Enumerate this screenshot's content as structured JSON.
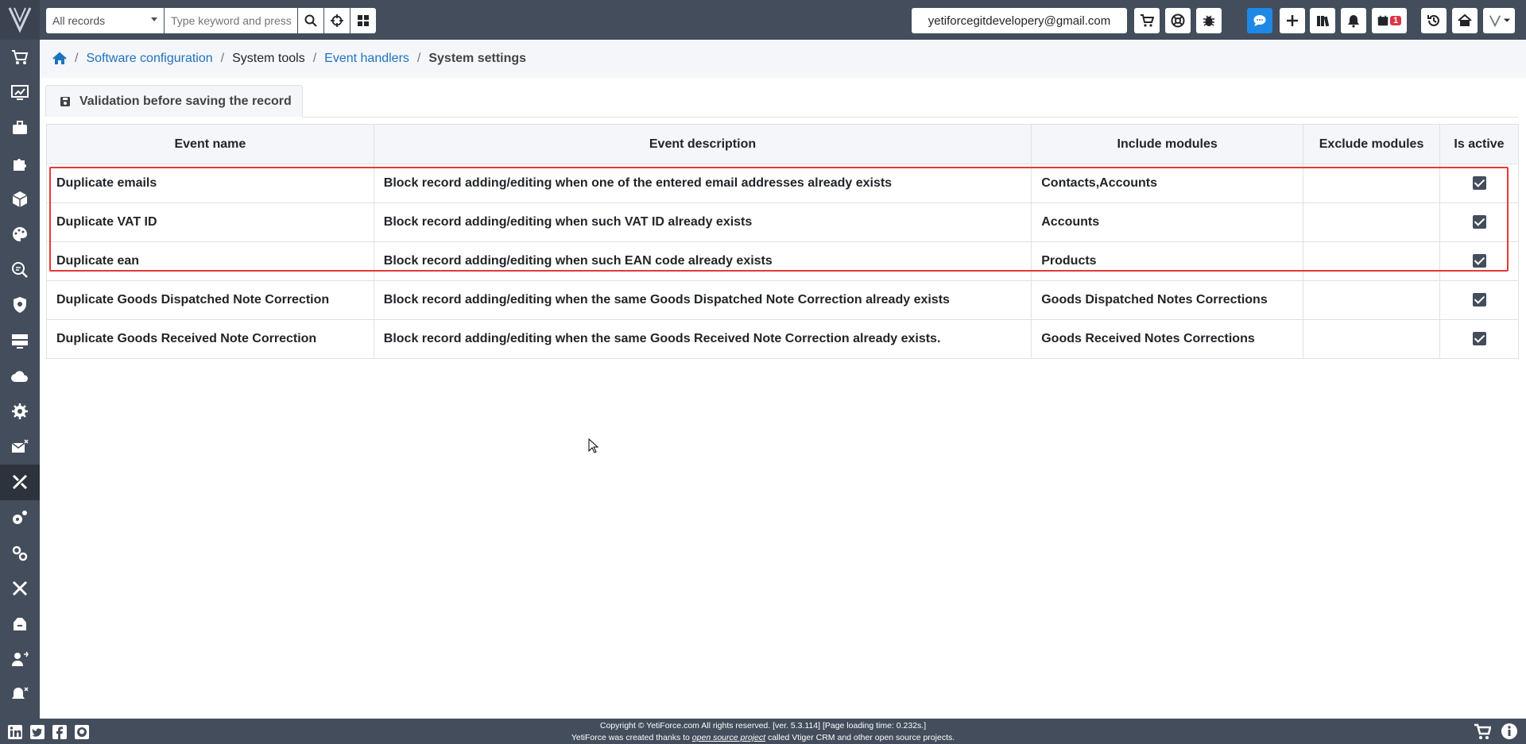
{
  "topbar": {
    "records_select": "All records",
    "search_placeholder": "Type keyword and press",
    "user_email": "yetiforcegitdevelopery@gmail.com",
    "calendar_badge": "1"
  },
  "breadcrumb": {
    "items": [
      "Software configuration",
      "System tools",
      "Event handlers",
      "System settings"
    ]
  },
  "tab": {
    "label": "Validation before saving the record"
  },
  "table": {
    "columns": [
      "Event name",
      "Event description",
      "Include modules",
      "Exclude modules",
      "Is active"
    ],
    "rows": [
      {
        "name": "Duplicate emails",
        "description": "Block record adding/editing when one of the entered email addresses already exists",
        "include": "Contacts,Accounts",
        "exclude": "",
        "active": true
      },
      {
        "name": "Duplicate VAT ID",
        "description": "Block record adding/editing when such VAT ID already exists",
        "include": "Accounts",
        "exclude": "",
        "active": true
      },
      {
        "name": "Duplicate ean",
        "description": "Block record adding/editing when such EAN code already exists",
        "include": "Products",
        "exclude": "",
        "active": true
      },
      {
        "name": "Duplicate Goods Dispatched Note Correction",
        "description": "Block record adding/editing when the same Goods Dispatched Note Correction already exists",
        "include": "Goods Dispatched Notes Corrections",
        "exclude": "",
        "active": true
      },
      {
        "name": "Duplicate Goods Received Note Correction",
        "description": "Block record adding/editing when the same Goods Received Note Correction already exists.",
        "include": "Goods Received Notes Corrections",
        "exclude": "",
        "active": true
      }
    ]
  },
  "footer": {
    "line1": "Copyright © YetiForce.com All rights reserved. [ver. 5.3.114] [Page loading time: 0.232s.]",
    "line2_pre": "YetiForce was created thanks to ",
    "line2_link": "open source project",
    "line2_post": " called Vtiger CRM and other open source projects."
  },
  "colors": {
    "sidebar": "#444d5b",
    "link": "#1e73be",
    "highlight": "#e53935",
    "accent_blue": "#1e88e5"
  }
}
